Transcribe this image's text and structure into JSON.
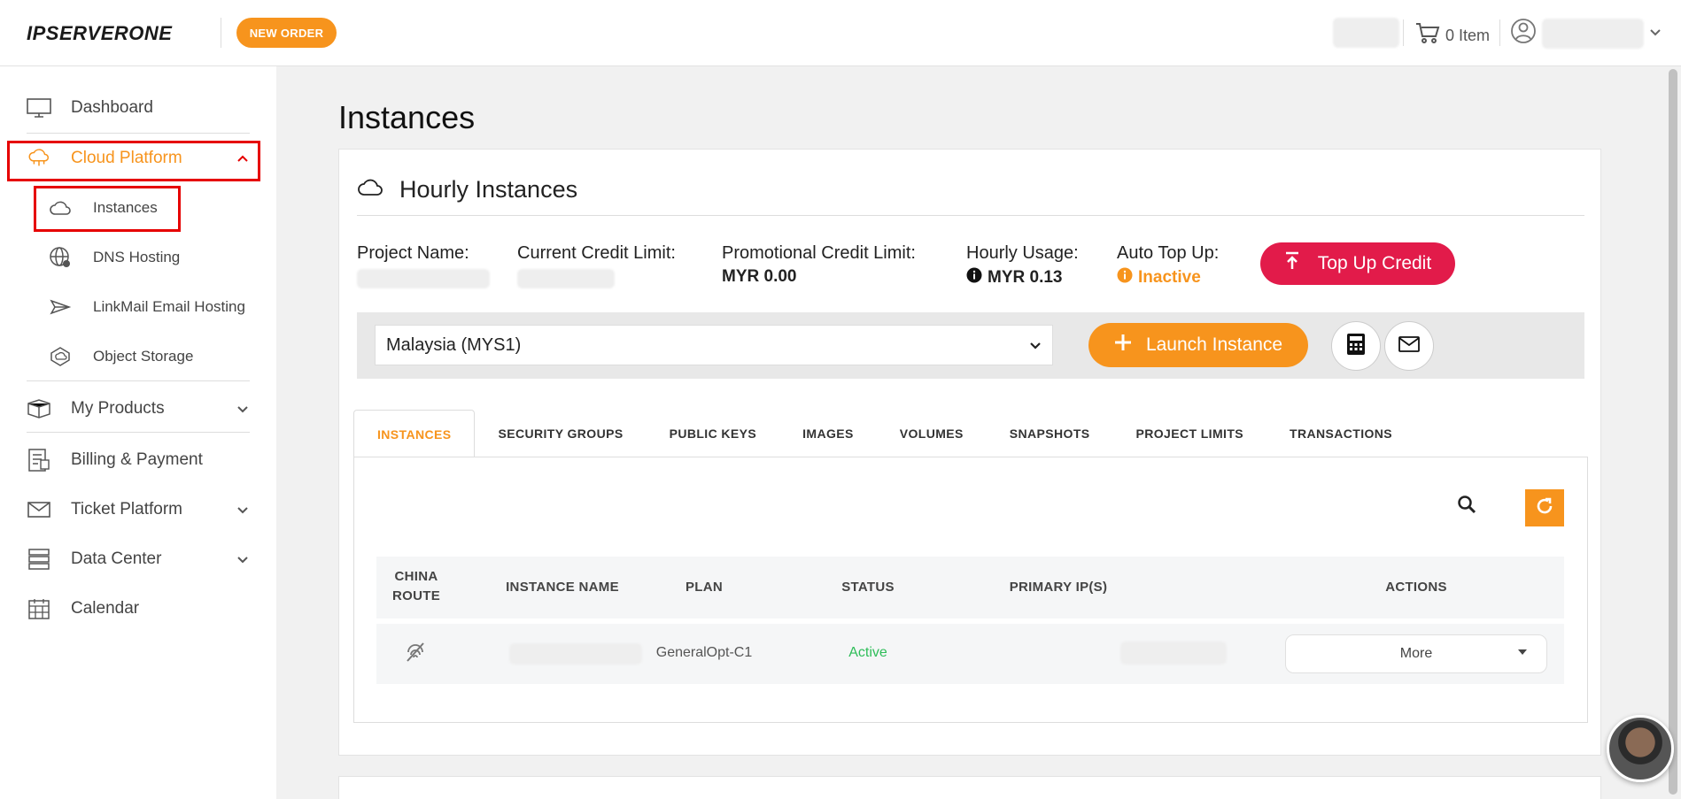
{
  "header": {
    "logo_text": "IPSERVERONE",
    "new_order": "NEW ORDER",
    "cart_label": "0 Item"
  },
  "sidebar": {
    "dashboard": "Dashboard",
    "cloud_platform": "Cloud Platform",
    "instances": "Instances",
    "dns_hosting": "DNS Hosting",
    "linkmail": "LinkMail Email Hosting",
    "object_storage": "Object Storage",
    "my_products": "My Products",
    "billing": "Billing & Payment",
    "ticket": "Ticket Platform",
    "data_center": "Data Center",
    "calendar": "Calendar"
  },
  "main": {
    "page_title": "Instances",
    "card_title": "Hourly Instances",
    "project_name_label": "Project Name:",
    "credit_limit_label": "Current Credit Limit:",
    "promo_label": "Promotional Credit Limit:",
    "promo_value": "MYR 0.00",
    "hourly_label": "Hourly Usage:",
    "hourly_value": "MYR 0.13",
    "autotopup_label": "Auto Top Up:",
    "autotopup_value": "Inactive",
    "topup_button": "Top Up Credit",
    "region_value": "Malaysia (MYS1)",
    "launch_button": "Launch Instance"
  },
  "tabs": [
    "INSTANCES",
    "SECURITY GROUPS",
    "PUBLIC KEYS",
    "IMAGES",
    "VOLUMES",
    "SNAPSHOTS",
    "PROJECT LIMITS",
    "TRANSACTIONS"
  ],
  "table": {
    "col_china_route": "CHINA ROUTE",
    "col_name": "INSTANCE NAME",
    "col_plan": "PLAN",
    "col_status": "STATUS",
    "col_ip": "PRIMARY IP(S)",
    "col_actions": "ACTIONS",
    "row_plan": "GeneralOpt-C1",
    "row_status": "Active",
    "row_action": "More"
  },
  "colors": {
    "brand_orange": "#f7941d",
    "topup_red": "#e21b4a",
    "status_green": "#2ebd59"
  }
}
